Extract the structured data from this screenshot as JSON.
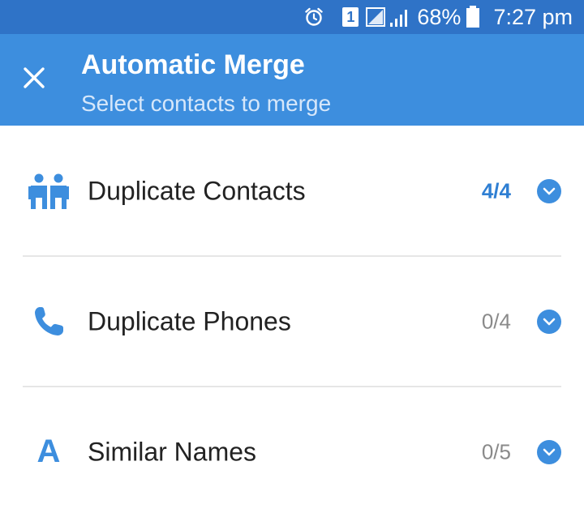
{
  "status_bar": {
    "icons": [
      "alarm-icon",
      "sim-1-icon",
      "no-signal-icon",
      "signal-bars-icon",
      "battery-icon"
    ],
    "sim_label": "1",
    "battery_percent": "68%",
    "time": "7:27 pm"
  },
  "app_bar": {
    "title": "Automatic Merge",
    "subtitle": "Select contacts to merge",
    "close_icon": "close-icon"
  },
  "rows": [
    {
      "icon": "people-icon",
      "label": "Duplicate Contacts",
      "count": "4/4",
      "active": true
    },
    {
      "icon": "phone-icon",
      "label": "Duplicate Phones",
      "count": "0/4",
      "active": false
    },
    {
      "icon": "letter-a-icon",
      "label": "Similar Names",
      "count": "0/5",
      "active": false,
      "letter": "A"
    }
  ],
  "colors": {
    "status_bar": "#2f73c7",
    "app_bar": "#3d8ede",
    "accent": "#2f7fd3",
    "text_primary": "#222222",
    "text_muted": "#8a8a8a"
  }
}
